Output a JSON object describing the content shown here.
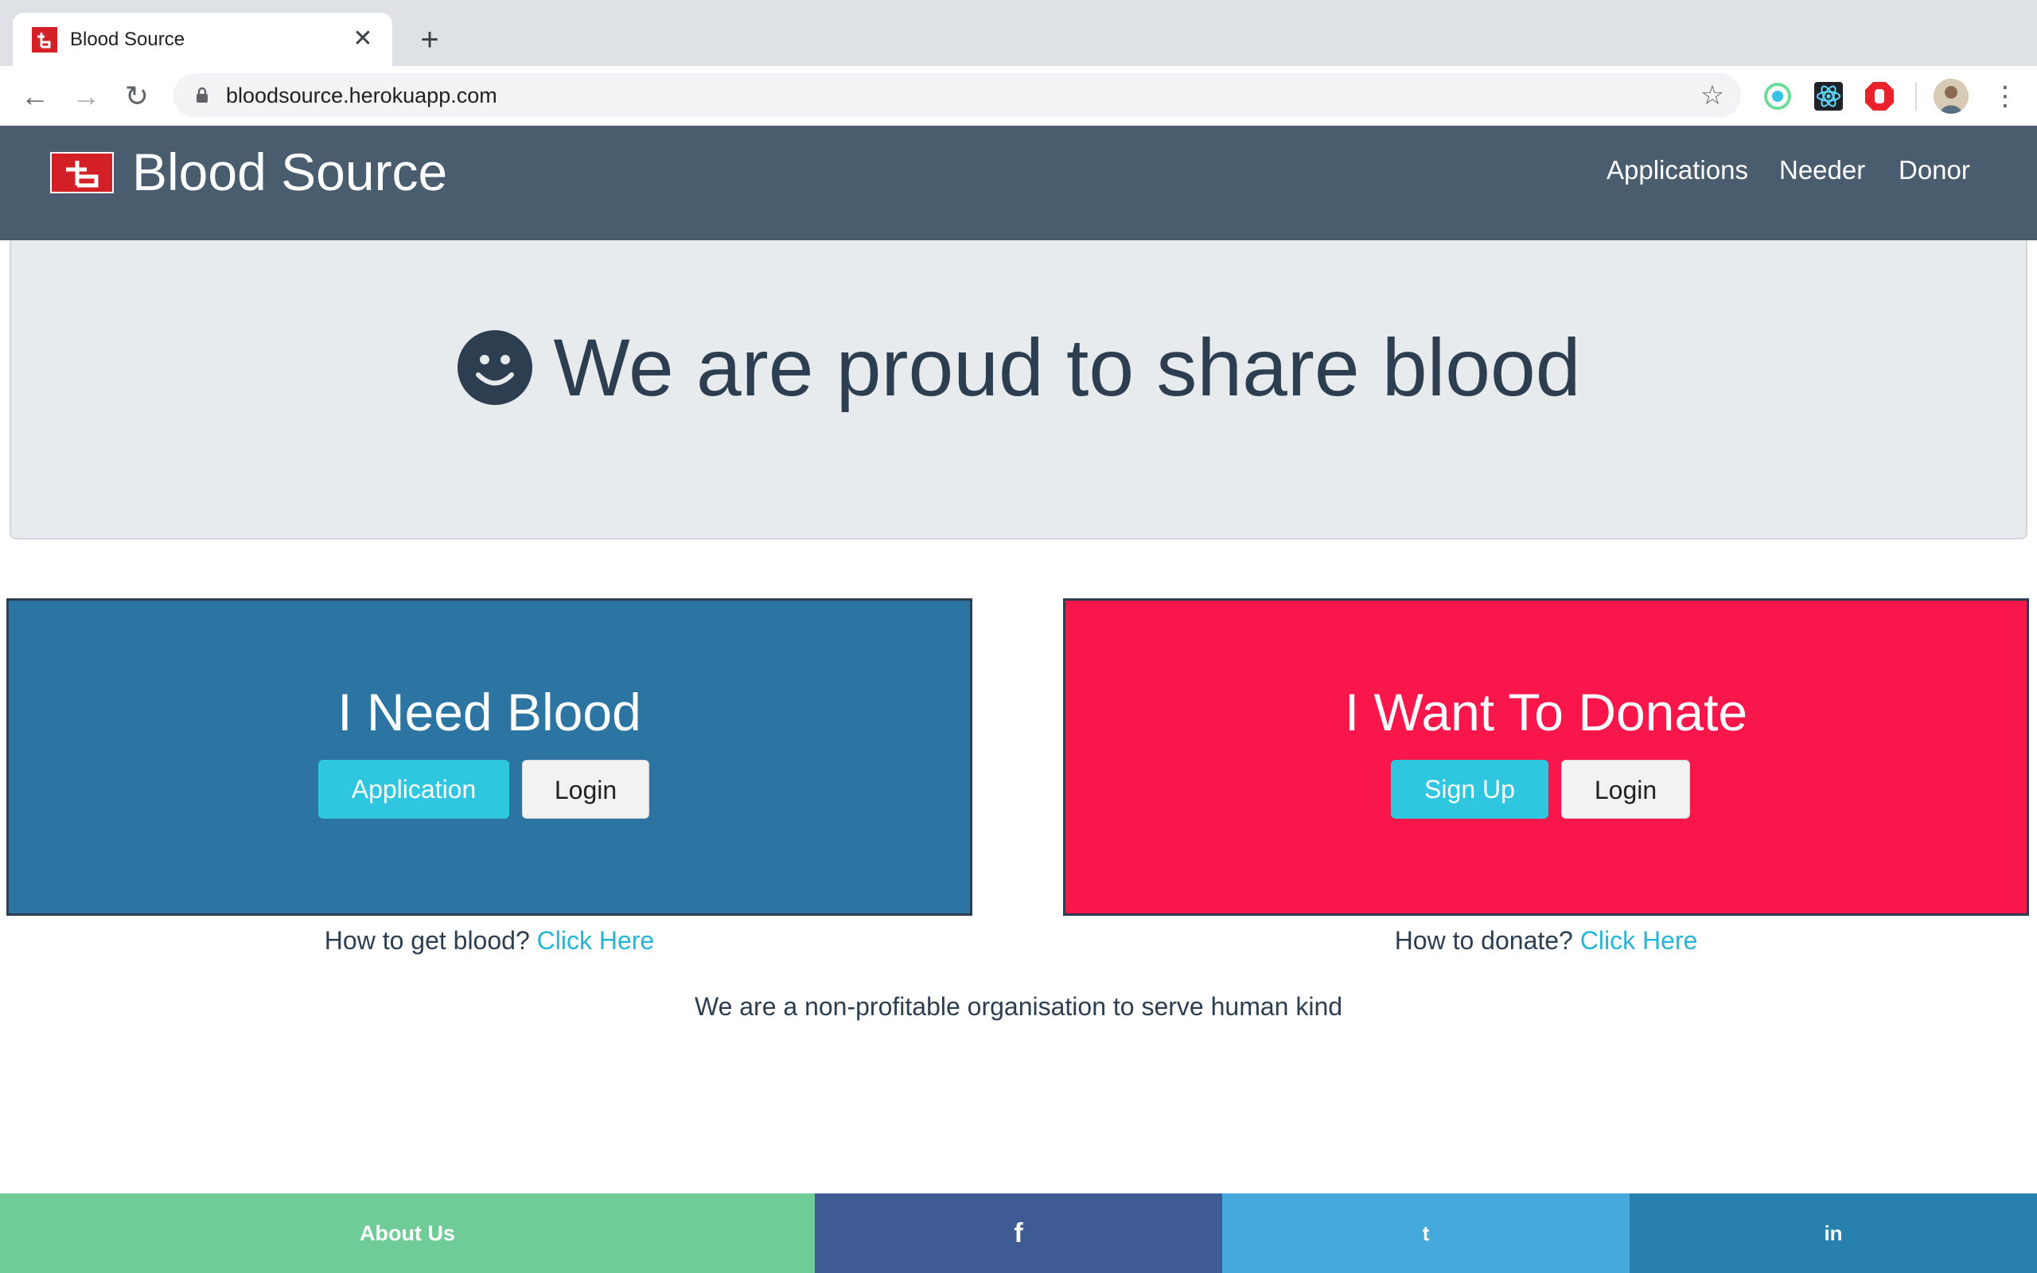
{
  "browser": {
    "tab_title": "Blood Source",
    "close_glyph": "✕",
    "new_tab_glyph": "+",
    "url": "bloodsource.herokuapp.com",
    "back_glyph": "←",
    "forward_glyph": "→",
    "reload_glyph": "↻",
    "star_glyph": "☆",
    "menu_glyph": "⋮",
    "extensions": [
      "timer-extension-icon",
      "react-devtools-icon",
      "adblock-icon"
    ]
  },
  "navbar": {
    "brand": "Blood Source",
    "links": [
      "Applications",
      "Needer",
      "Donor"
    ],
    "color": "#4a5d6f"
  },
  "hero": {
    "icon": "smiley-icon",
    "headline": "We are proud to share blood"
  },
  "need_card": {
    "title": "I Need Blood",
    "primary_button": "Application",
    "secondary_button": "Login",
    "help_text": "How to get blood?",
    "help_link": "Click Here",
    "color": "#2c75a3"
  },
  "donate_card": {
    "title": "I Want To Donate",
    "primary_button": "Sign Up",
    "secondary_button": "Login",
    "help_text": "How to donate?",
    "help_link": "Click Here",
    "color": "#f9164b"
  },
  "mission": "We are a non-profitable organisation to serve human kind",
  "footer": {
    "about": "About Us",
    "facebook": "f",
    "twitter": "t",
    "linkedin": "in"
  },
  "colors": {
    "accent_button": "#2fc6df",
    "link": "#26b5d6",
    "text": "#2c3e50"
  }
}
